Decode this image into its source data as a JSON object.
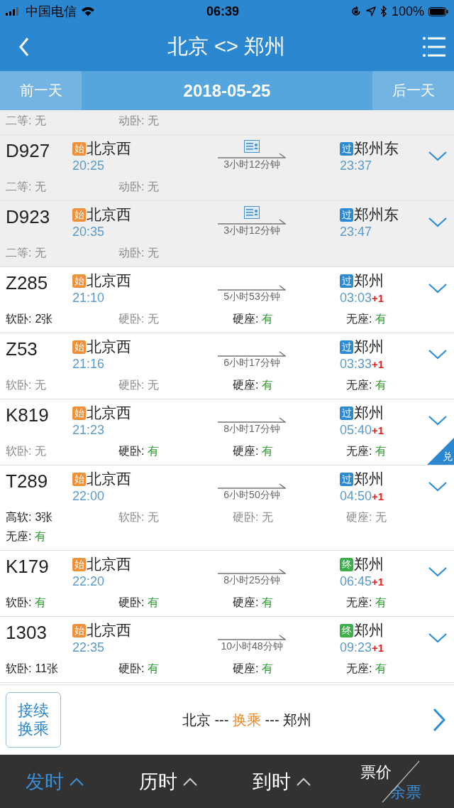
{
  "status_bar": {
    "carrier": "中国电信",
    "time": "06:39",
    "battery": "100%"
  },
  "nav": {
    "title": "北京 <> 郑州"
  },
  "date_bar": {
    "prev": "前一天",
    "date": "2018-05-25",
    "next": "后一天"
  },
  "trains": [
    {
      "kind": "partial",
      "sold_out": true,
      "seats": [
        {
          "label": "二等:",
          "value": "无",
          "available": false,
          "highlight": false
        },
        {
          "label": "动卧:",
          "value": "无",
          "available": false,
          "highlight": false
        }
      ]
    },
    {
      "kind": "full",
      "sold_out": true,
      "train": "D927",
      "origin_badge": {
        "text": "始",
        "color": "#f0913a"
      },
      "origin": "北京西",
      "depart": "20:25",
      "id_card": true,
      "duration": "3小时12分钟",
      "dest_badge": {
        "text": "过",
        "color": "#2a8ad4"
      },
      "dest": "郑州东",
      "arrive": "23:37",
      "seats": [
        {
          "label": "二等:",
          "value": "无",
          "available": false,
          "highlight": false
        },
        {
          "label": "动卧:",
          "value": "无",
          "available": false,
          "highlight": false
        }
      ]
    },
    {
      "kind": "full",
      "sold_out": true,
      "train": "D923",
      "origin_badge": {
        "text": "始",
        "color": "#f0913a"
      },
      "origin": "北京西",
      "depart": "20:35",
      "id_card": true,
      "duration": "3小时12分钟",
      "dest_badge": {
        "text": "过",
        "color": "#2a8ad4"
      },
      "dest": "郑州东",
      "arrive": "23:47",
      "seats": [
        {
          "label": "二等:",
          "value": "无",
          "available": false,
          "highlight": false
        },
        {
          "label": "动卧:",
          "value": "无",
          "available": false,
          "highlight": false
        }
      ]
    },
    {
      "kind": "full",
      "sold_out": false,
      "train": "Z285",
      "origin_badge": {
        "text": "始",
        "color": "#f0913a"
      },
      "origin": "北京西",
      "depart": "21:10",
      "id_card": false,
      "duration": "5小时53分钟",
      "dest_badge": {
        "text": "过",
        "color": "#2a8ad4"
      },
      "dest": "郑州",
      "arrive": "03:03",
      "next_day": "+1",
      "seats": [
        {
          "label": "软卧:",
          "value": "2张",
          "available": true,
          "highlight": false
        },
        {
          "label": "硬卧:",
          "value": "无",
          "available": false,
          "highlight": false
        },
        {
          "label": "硬座:",
          "value": "有",
          "available": true,
          "highlight": true
        },
        {
          "label": "无座:",
          "value": "有",
          "available": true,
          "highlight": true
        }
      ]
    },
    {
      "kind": "full",
      "sold_out": false,
      "train": "Z53",
      "origin_badge": {
        "text": "始",
        "color": "#f0913a"
      },
      "origin": "北京西",
      "depart": "21:16",
      "id_card": false,
      "duration": "6小时17分钟",
      "dest_badge": {
        "text": "过",
        "color": "#2a8ad4"
      },
      "dest": "郑州",
      "arrive": "03:33",
      "next_day": "+1",
      "seats": [
        {
          "label": "软卧:",
          "value": "无",
          "available": false,
          "highlight": false
        },
        {
          "label": "硬卧:",
          "value": "无",
          "available": false,
          "highlight": false
        },
        {
          "label": "硬座:",
          "value": "有",
          "available": true,
          "highlight": true
        },
        {
          "label": "无座:",
          "value": "有",
          "available": true,
          "highlight": true
        }
      ]
    },
    {
      "kind": "full",
      "sold_out": false,
      "train": "K819",
      "origin_badge": {
        "text": "始",
        "color": "#f0913a"
      },
      "origin": "北京西",
      "depart": "21:23",
      "id_card": false,
      "duration": "8小时17分钟",
      "dest_badge": {
        "text": "过",
        "color": "#2a8ad4"
      },
      "dest": "郑州",
      "arrive": "05:40",
      "next_day": "+1",
      "corner_badge": "兑",
      "seats": [
        {
          "label": "软卧:",
          "value": "无",
          "available": false,
          "highlight": false
        },
        {
          "label": "硬卧:",
          "value": "有",
          "available": true,
          "highlight": true
        },
        {
          "label": "硬座:",
          "value": "有",
          "available": true,
          "highlight": true
        },
        {
          "label": "无座:",
          "value": "有",
          "available": true,
          "highlight": true
        }
      ]
    },
    {
      "kind": "full",
      "sold_out": false,
      "train": "T289",
      "origin_badge": {
        "text": "始",
        "color": "#f0913a"
      },
      "origin": "北京西",
      "depart": "22:00",
      "id_card": false,
      "duration": "6小时50分钟",
      "dest_badge": {
        "text": "过",
        "color": "#2a8ad4"
      },
      "dest": "郑州",
      "arrive": "04:50",
      "next_day": "+1",
      "seats": [
        {
          "label": "高软:",
          "value": "3张",
          "available": true,
          "highlight": false
        },
        {
          "label": "软卧:",
          "value": "无",
          "available": false,
          "highlight": false
        },
        {
          "label": "硬卧:",
          "value": "无",
          "available": false,
          "highlight": false
        },
        {
          "label": "硬座:",
          "value": "无",
          "available": false,
          "highlight": false
        },
        {
          "label": "无座:",
          "value": "有",
          "available": true,
          "highlight": true
        }
      ]
    },
    {
      "kind": "full",
      "sold_out": false,
      "train": "K179",
      "origin_badge": {
        "text": "始",
        "color": "#f0913a"
      },
      "origin": "北京西",
      "depart": "22:20",
      "id_card": false,
      "duration": "8小时25分钟",
      "dest_badge": {
        "text": "终",
        "color": "#3aae47"
      },
      "dest": "郑州",
      "arrive": "06:45",
      "next_day": "+1",
      "seats": [
        {
          "label": "软卧:",
          "value": "有",
          "available": true,
          "highlight": true
        },
        {
          "label": "硬卧:",
          "value": "有",
          "available": true,
          "highlight": true
        },
        {
          "label": "硬座:",
          "value": "有",
          "available": true,
          "highlight": true
        },
        {
          "label": "无座:",
          "value": "有",
          "available": true,
          "highlight": true
        }
      ]
    },
    {
      "kind": "full",
      "sold_out": false,
      "train": "1303",
      "origin_badge": {
        "text": "始",
        "color": "#f0913a"
      },
      "origin": "北京西",
      "depart": "22:35",
      "id_card": false,
      "duration": "10小时48分钟",
      "dest_badge": {
        "text": "终",
        "color": "#3aae47"
      },
      "dest": "郑州",
      "arrive": "09:23",
      "next_day": "+1",
      "seats": [
        {
          "label": "软卧:",
          "value": "11张",
          "available": true,
          "highlight": false
        },
        {
          "label": "硬卧:",
          "value": "有",
          "available": true,
          "highlight": true
        },
        {
          "label": "硬座:",
          "value": "有",
          "available": true,
          "highlight": true
        },
        {
          "label": "无座:",
          "value": "有",
          "available": true,
          "highlight": true
        }
      ]
    }
  ],
  "transfer": {
    "button": "接续换乘",
    "route": [
      {
        "text": "北京 --- ",
        "highlight": false
      },
      {
        "text": "换乘",
        "highlight": true
      },
      {
        "text": " --- 郑州",
        "highlight": false
      }
    ]
  },
  "sort_tabs": [
    {
      "label": "发时",
      "selected": true
    },
    {
      "label": "历时",
      "selected": false
    },
    {
      "label": "到时",
      "selected": false
    }
  ],
  "price_toggle": [
    {
      "label": "票价",
      "selected": false
    },
    {
      "label": "余票",
      "selected": true
    }
  ]
}
